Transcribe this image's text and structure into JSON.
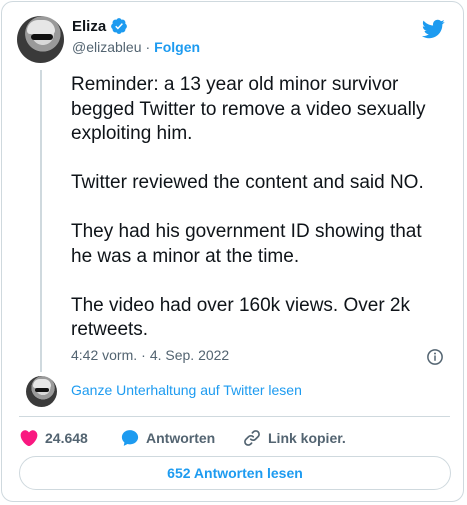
{
  "author": {
    "name": "Eliza",
    "handle": "@elizableu",
    "separator": "·",
    "follow_label": "Folgen"
  },
  "tweet": {
    "text": "Reminder: a 13 year old minor survivor\nbegged Twitter to remove a video sexually\nexploiting him.\n\nTwitter reviewed the content and said NO.\n\nThey had his government ID showing that\nhe was a minor at the time.\n\nThe video had over 160k views. Over 2k\nretweets.",
    "time": "4:42 vorm.",
    "separator": "·",
    "date": "4. Sep. 2022"
  },
  "conversation": {
    "link_label": "Ganze Unterhaltung auf Twitter lesen"
  },
  "actions": {
    "likes_count": "24.648",
    "reply_label": "Antworten",
    "copy_link_label": "Link kopier."
  },
  "footer": {
    "read_replies_label": "652 Antworten lesen"
  },
  "colors": {
    "brand_blue": "#1d9bf0",
    "like_red": "#f91880",
    "muted_text": "#536471",
    "border": "#cfd9de"
  },
  "icons": [
    "verified-badge-icon",
    "twitter-bird-icon",
    "info-icon",
    "heart-icon",
    "reply-bubble-icon",
    "link-icon"
  ]
}
